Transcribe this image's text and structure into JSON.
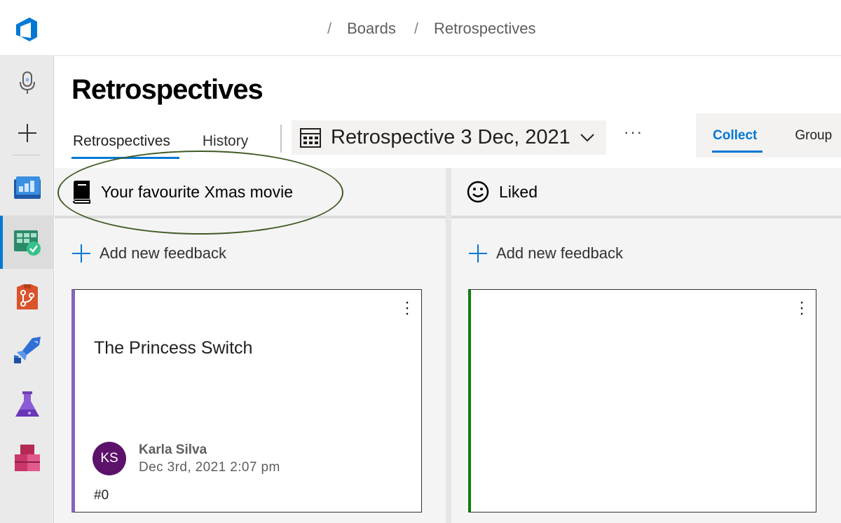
{
  "header": {
    "breadcrumb": [
      {
        "sep": "/",
        "label": "Boards"
      },
      {
        "sep": "/",
        "label": "Retrospectives"
      }
    ]
  },
  "sidebar": {
    "items": [
      {
        "icon": "microphone-icon"
      },
      {
        "icon": "plus-icon"
      },
      {
        "icon": "overview-icon"
      },
      {
        "icon": "boards-icon",
        "active": true
      },
      {
        "icon": "repos-icon"
      },
      {
        "icon": "pipelines-icon"
      },
      {
        "icon": "test-plans-icon"
      },
      {
        "icon": "artifacts-icon"
      }
    ]
  },
  "main": {
    "title": "Retrospectives",
    "tabs": [
      {
        "label": "Retrospectives",
        "active": true
      },
      {
        "label": "History"
      }
    ],
    "retro_selector": "Retrospective 3 Dec, 2021",
    "more": "···",
    "phases": {
      "collect": "Collect",
      "group": "Group"
    }
  },
  "columns": [
    {
      "title": "Your favourite Xmas movie",
      "icon": "book-icon",
      "accent": "#8764b8",
      "add_label": "Add new feedback",
      "card": {
        "text": "The Princess Switch",
        "initials": "KS",
        "author": "Karla Silva",
        "date": "Dec 3rd, 2021 2:07 pm",
        "id": "#0"
      }
    },
    {
      "title": "Liked",
      "icon": "smiley-icon",
      "accent": "#107c10",
      "add_label": "Add new feedback"
    }
  ]
}
